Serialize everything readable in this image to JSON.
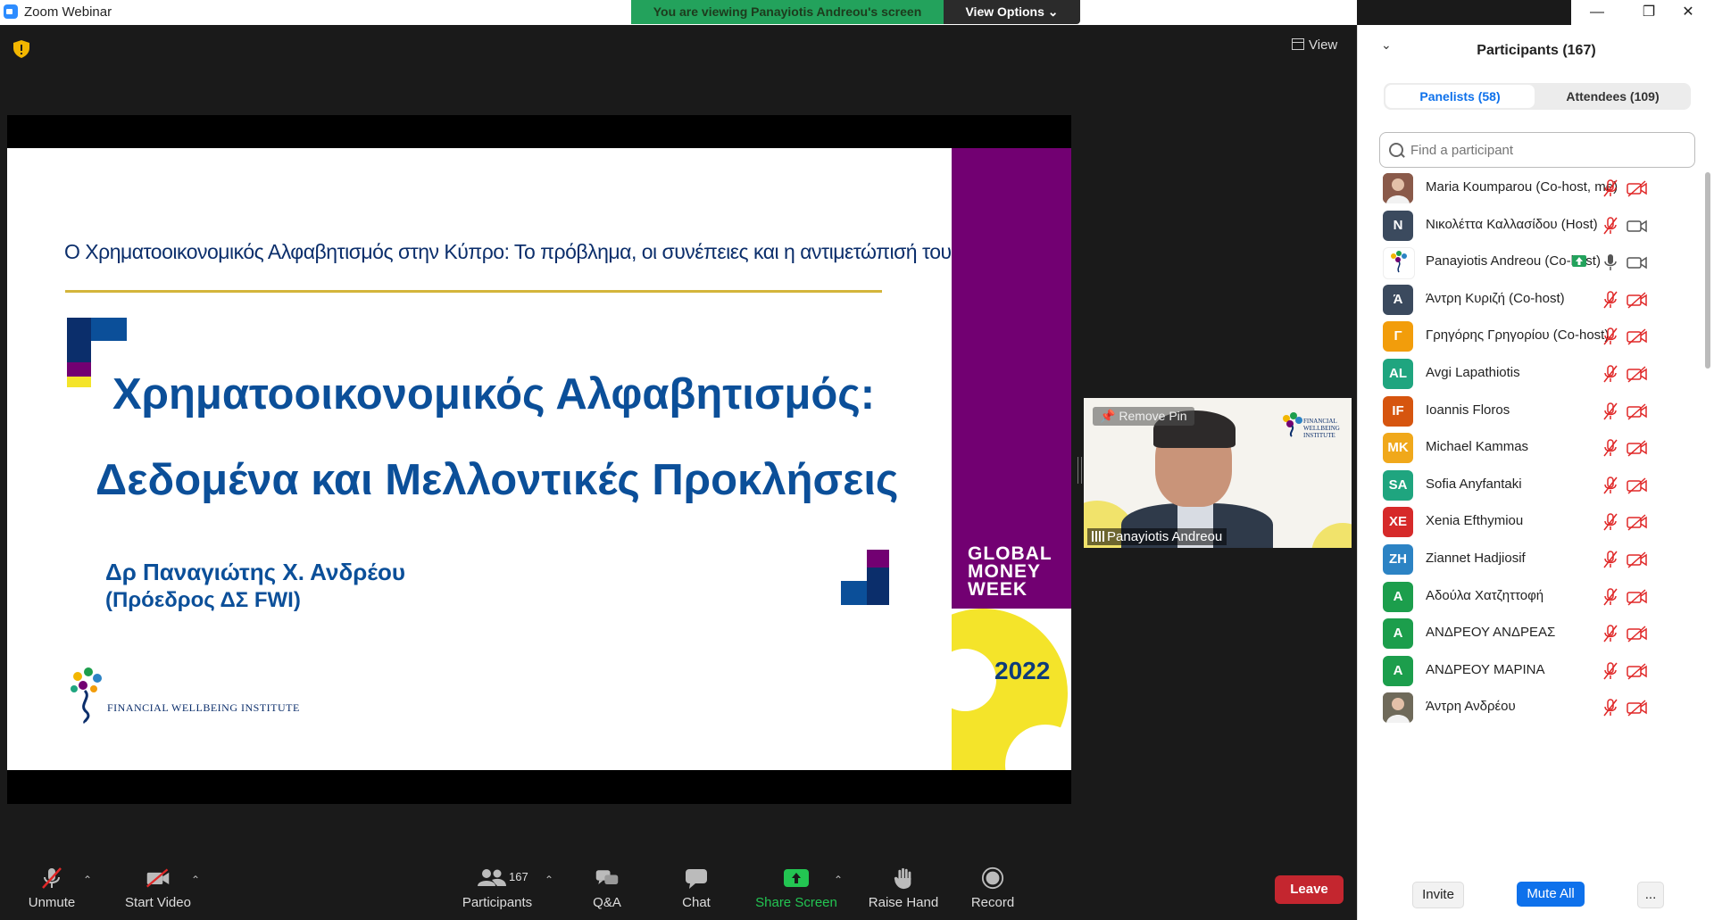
{
  "window": {
    "app_title": "Zoom Webinar",
    "viewing_banner": "You are viewing Panayiotis Andreou's screen",
    "view_options": "View Options ⌄",
    "view_button": "View"
  },
  "slide": {
    "subtitle": "Ο Χρηματοοικονομικός Αλφαβητισμός στην Κύπρο: Το πρόβλημα, οι συνέπειες και η αντιμετώπισή του",
    "title_line1": "Χρηματοοικονομικός Αλφαβητισμός:",
    "title_line2": "Δεδομένα και Μελλοντικές Προκλήσεις",
    "author_line1": "Δρ Παναγιώτης Χ. Ανδρέου",
    "author_line2": "(Πρόεδρος ΔΣ FWI)",
    "org_logo_text": "FINANCIAL WELLBEING INSTITUTE",
    "event_logo": [
      "GLOBAL",
      "MONEY",
      "WEEK"
    ],
    "year": "2022",
    "colors": {
      "purple": "#720072",
      "blue": "#0b4f99",
      "gold": "#d4b53b",
      "yellow": "#f4e42a"
    }
  },
  "speaker_video": {
    "remove_pin": "Remove Pin",
    "name": "Panayiotis Andreou",
    "logo_text": "FINANCIAL WELLBEING INSTITUTE"
  },
  "toolbar": {
    "unmute": "Unmute",
    "start_video": "Start Video",
    "participants_count": "167",
    "participants": "Participants",
    "qa": "Q&A",
    "chat": "Chat",
    "share_screen": "Share Screen",
    "raise_hand": "Raise Hand",
    "record": "Record",
    "leave": "Leave"
  },
  "participants_panel": {
    "title": "Participants (167)",
    "tabs": {
      "panelists": "Panelists (58)",
      "attendees": "Attendees (109)"
    },
    "search_placeholder": "Find a participant",
    "list": [
      {
        "initials": "",
        "name": "Maria Koumparou (Co-host, me)",
        "color": "#8a5a4a",
        "photo": true,
        "mic": "off",
        "video": "off"
      },
      {
        "initials": "N",
        "name": "Νικολέττα Καλλασίδου (Host)",
        "color": "#3b4a5e",
        "mic": "off",
        "video": "on"
      },
      {
        "initials": "",
        "name": "Panayiotis Andreou (Co-host)",
        "color": "#ffffff",
        "logo": true,
        "sharing": true,
        "mic": "on",
        "video": "on"
      },
      {
        "initials": "Ά",
        "name": "Άντρη Κυριζή (Co-host)",
        "color": "#3b4a5e",
        "mic": "off",
        "video": "off"
      },
      {
        "initials": "Γ",
        "name": "Γρηγόρης Γρηγορίου (Co-host)",
        "color": "#f29d0b",
        "mic": "off",
        "video": "off"
      },
      {
        "initials": "AL",
        "name": "Avgi Lapathiotis",
        "color": "#1fa57f",
        "mic": "off",
        "video": "off"
      },
      {
        "initials": "IF",
        "name": "Ioannis Floros",
        "color": "#d6550f",
        "mic": "off",
        "video": "off"
      },
      {
        "initials": "MK",
        "name": "Michael Kammas",
        "color": "#f0a81b",
        "mic": "off",
        "video": "off"
      },
      {
        "initials": "SA",
        "name": "Sofia Anyfantaki",
        "color": "#1fa57f",
        "mic": "off",
        "video": "off"
      },
      {
        "initials": "XE",
        "name": "Xenia Efthymiou",
        "color": "#d62a2a",
        "mic": "off",
        "video": "off"
      },
      {
        "initials": "ZH",
        "name": "Ziannet Hadjiosif",
        "color": "#2c83c4",
        "mic": "off",
        "video": "off"
      },
      {
        "initials": "A",
        "name": "Αδούλα Χατζηττοφή",
        "color": "#1c9e4c",
        "mic": "off",
        "video": "off"
      },
      {
        "initials": "A",
        "name": "ΑΝΔΡΕΟΥ ΑΝΔΡΕΑΣ",
        "color": "#1c9e4c",
        "mic": "off",
        "video": "off"
      },
      {
        "initials": "A",
        "name": "ΑΝΔΡΕΟΥ ΜΑΡΙΝΑ",
        "color": "#1c9e4c",
        "mic": "off",
        "video": "off"
      },
      {
        "initials": "",
        "name": "Άντρη Ανδρέου",
        "color": "#6f6a5a",
        "photo": true,
        "mic": "off",
        "video": "off"
      }
    ],
    "invite": "Invite",
    "mute_all": "Mute All",
    "more": "..."
  }
}
